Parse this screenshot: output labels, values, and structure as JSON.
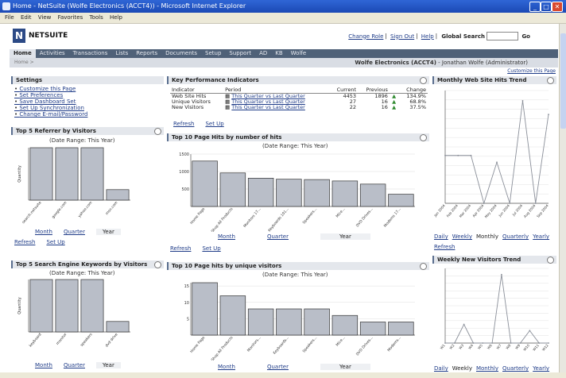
{
  "window": {
    "title": "Home - NetSuite (Wolfe Electronics (ACCT4)) - Microsoft Internet Explorer"
  },
  "menu": [
    "File",
    "Edit",
    "View",
    "Favorites",
    "Tools",
    "Help"
  ],
  "header": {
    "logo_text": "NETSUITE",
    "top_links": [
      "Change Role",
      "Sign Out",
      "Help"
    ],
    "global_search_label": "Global Search",
    "go_label": "Go",
    "company": "Wolfe Electronics (ACCT4)",
    "user": "Jonathan Wolfe (Administrator)",
    "breadcrumb": "Home >",
    "customize_link": "Customize this Page"
  },
  "tabs": [
    "Home",
    "Activities",
    "Transactions",
    "Lists",
    "Reports",
    "Documents",
    "Setup",
    "Support",
    "AD",
    "KB",
    "Wolfe"
  ],
  "settings": {
    "title": "Settings",
    "links": [
      "Customize this Page",
      "Set Preferences",
      "Save Dashboard  Set",
      "Set Up Synchronization",
      "Change E-mail/Password"
    ]
  },
  "kpi": {
    "title": "Key Performance Indicators",
    "headers": [
      "Indicator",
      "Period",
      "Current",
      "Previous",
      "Change"
    ],
    "rows": [
      {
        "indicator": "Web Site Hits",
        "period": "This Quarter vs Last Quarter",
        "current": "4453",
        "previous": "1896",
        "change": "134.9%"
      },
      {
        "indicator": "Unique Visitors",
        "period": "This Quarter vs Last Quarter",
        "current": "27",
        "previous": "16",
        "change": "68.8%"
      },
      {
        "indicator": "New Visitors",
        "period": "This Quarter vs Last Quarter",
        "current": "22",
        "previous": "16",
        "change": "37.5%"
      }
    ],
    "refresh_label": "Refresh",
    "setup_label": "Set Up"
  },
  "range_tabs": {
    "month": "Month",
    "quarter": "Quarter",
    "year": "Year"
  },
  "period_tabs": [
    "Daily",
    "Weekly",
    "Monthly",
    "Quarterly",
    "Yearly"
  ],
  "date_range": "(Date Range: This Year)",
  "refresh_label": "Refresh",
  "setup_label": "Set Up",
  "colors": {
    "bar_fill": "#b9bec8",
    "bar_stroke": "#333333",
    "line": "#8a8f99",
    "header_bg": "#e4e7ec",
    "tab_bg": "#4f6178"
  },
  "chart_data": [
    {
      "id": "referrers",
      "title": "Top 5 Referrer by Visitors",
      "type": "bar",
      "ylabel": "Quantity",
      "ylim": [
        0,
        10
      ],
      "categories": [
        "search.netsuite",
        "google.com",
        "yahoo.com",
        "msn.com"
      ],
      "values": [
        10,
        10,
        10,
        2
      ]
    },
    {
      "id": "keywords",
      "title": "Top 5 Search Engine Keywords by Visitors",
      "type": "bar",
      "ylabel": "Quantity",
      "ylim": [
        0,
        10
      ],
      "categories": [
        "keyboard",
        "monitor",
        "speakers",
        "dvd drive"
      ],
      "values": [
        10,
        10,
        10,
        2
      ]
    },
    {
      "id": "pagehits",
      "title": "Top 10 Page Hits by number of hits",
      "type": "bar",
      "yticks": [
        500,
        1000,
        1500
      ],
      "ylim": [
        0,
        1500
      ],
      "categories": [
        "Home Page",
        "Shop All Products",
        "Monitors 17...",
        "Keyboards 101...",
        "Speakers...",
        "Mice...",
        "DVD Drives...",
        "Modems 17..."
      ],
      "values": [
        1300,
        960,
        810,
        780,
        770,
        730,
        640,
        350
      ]
    },
    {
      "id": "uniquevisitors",
      "title": "Top 10 Page hits by unique visitors",
      "type": "bar",
      "yticks": [
        5,
        10,
        15
      ],
      "ylim": [
        0,
        16
      ],
      "categories": [
        "Home Page",
        "Shop All Products",
        "Monitors...",
        "Keyboards...",
        "Speakers...",
        "Mice...",
        "DVD Drives...",
        "Modems..."
      ],
      "values": [
        16,
        12,
        8,
        8,
        8,
        6,
        4,
        4
      ]
    },
    {
      "id": "webhits",
      "title": "Monthly Web Site Hits Trend",
      "type": "line",
      "ylim": [
        0,
        3300
      ],
      "categories": [
        "Jan 2004",
        "Feb 2004",
        "Mar 2004",
        "Apr 2004",
        "May 2004",
        "Jun 2004",
        "Jul 2004",
        "Aug 2004",
        "Sep 2004"
      ],
      "values": [
        1400,
        1400,
        1400,
        0,
        1200,
        0,
        3000,
        0,
        2600
      ]
    },
    {
      "id": "newvisitors",
      "title": "Weekly New Visitors Trend",
      "type": "line",
      "ylim": [
        0,
        12
      ],
      "categories": [
        "W1",
        "W2",
        "W3",
        "W4",
        "W5",
        "W6",
        "W7",
        "W8",
        "W9",
        "W10",
        "W11",
        "W12"
      ],
      "values": [
        0,
        0,
        3,
        0,
        0,
        0,
        11,
        0,
        0,
        2,
        0,
        0
      ]
    }
  ]
}
